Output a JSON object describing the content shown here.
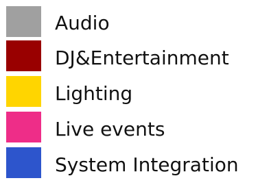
{
  "legend": {
    "items": [
      {
        "label": "Audio",
        "color": "#a0a0a0"
      },
      {
        "label": "DJ&Entertainment",
        "color": "#990000"
      },
      {
        "label": "Lighting",
        "color": "#ffd500"
      },
      {
        "label": "Live events",
        "color": "#ee2d88"
      },
      {
        "label": "System Integration",
        "color": "#2d55cc"
      }
    ]
  }
}
